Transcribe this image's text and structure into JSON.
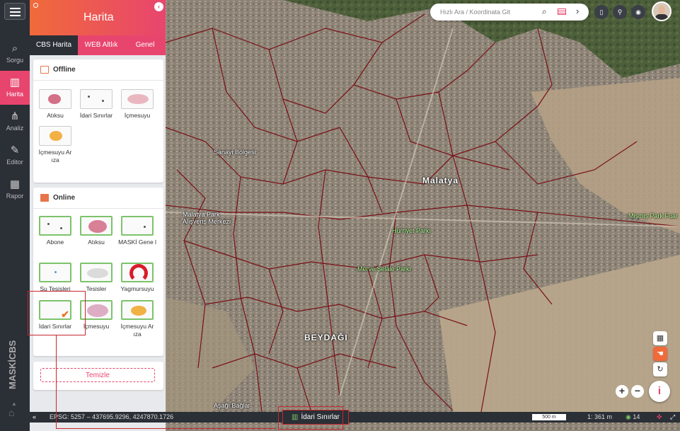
{
  "app": {
    "brand": "MASKİCBS"
  },
  "nav": {
    "items": [
      {
        "label": "Sorgu",
        "icon": "search-icon"
      },
      {
        "label": "Harita",
        "icon": "map-icon",
        "active": true
      },
      {
        "label": "Analiz",
        "icon": "analysis-icon"
      },
      {
        "label": "Editor",
        "icon": "edit-icon"
      },
      {
        "label": "Rapor",
        "icon": "report-icon"
      }
    ]
  },
  "panel": {
    "title": "Harita",
    "tabs": [
      "CBS Harita",
      "WEB Altlık",
      "Genel"
    ],
    "offline": {
      "title": "Offline",
      "layers": [
        "Atıksu",
        "İdari Sınırlar",
        "İçmesuyu",
        "İçmesuyu Ar ıza"
      ]
    },
    "online": {
      "title": "Online",
      "layers": [
        "Abone",
        "Atıksu",
        "MASKİ Gene l",
        "Su Tesisleri",
        "Tesisler",
        "Yagmursuyu",
        "İdari Sınırlar",
        "İçmesuyu",
        "İçmesuyu Ar ıza"
      ]
    },
    "clear_label": "Temizle"
  },
  "search": {
    "placeholder": "Hızlı Ara / Koordinata Git"
  },
  "map_labels": {
    "city": "Malatya",
    "district": "BEYDAĞI",
    "park1": "Hürriyet Parkı",
    "park2": "Merve Şelale Parkı",
    "park3": "Mişmiş Park Fuar",
    "mall": "Malatya Park Alışveriş Merkezi",
    "industry": "Sanayi Bölgesi",
    "south": "Aşağı Bağlar"
  },
  "status": {
    "epsg": "EPSG: 5257",
    "coords": "437695.9296, 4247870.1726",
    "active_layer": "İdari Sınırlar",
    "scale": "500 m",
    "ratio": "1: 361 m",
    "zoom": "14"
  },
  "colors": {
    "accent": "#e8456e",
    "orange": "#f06a3a",
    "dark": "#2b2f36",
    "boundary": "#7a0f16",
    "selected": "#7dc36b"
  }
}
